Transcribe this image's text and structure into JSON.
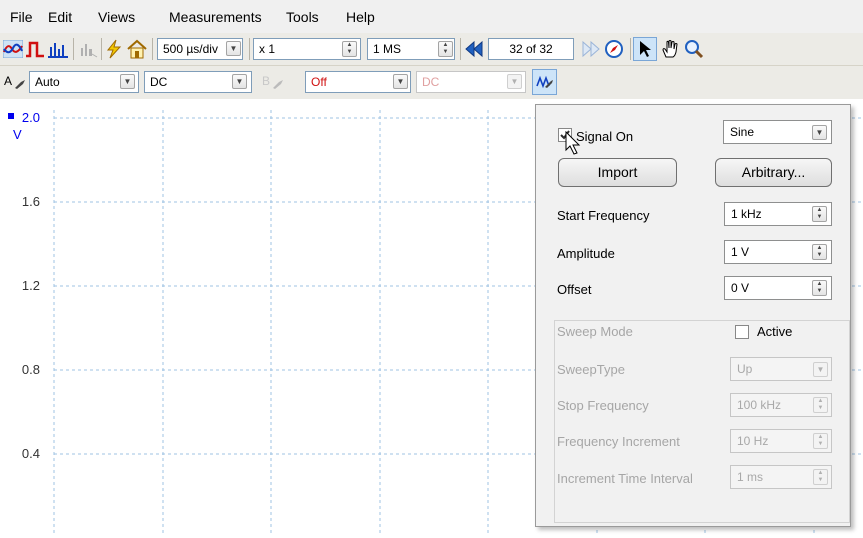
{
  "menu": {
    "file": "File",
    "edit": "Edit",
    "views": "Views",
    "measurements": "Measurements",
    "tools": "Tools",
    "help": "Help"
  },
  "toolbar": {
    "timebase": "500 µs/div",
    "zoom": "x 1",
    "samples": "1 MS",
    "buffer": "32 of 32"
  },
  "channels": {
    "a_label": "A",
    "a_range": "Auto",
    "a_coupling": "DC",
    "b_label": "B",
    "b_range": "Off",
    "b_coupling": "DC"
  },
  "chart_data": {
    "type": "line",
    "ylabel": "V",
    "yticks": [
      "2.0",
      "1.6",
      "1.2",
      "0.8",
      "0.4"
    ],
    "ylim": [
      0.0,
      2.0
    ],
    "grid": true,
    "series": []
  },
  "signal_panel": {
    "signal_on_label": "Signal On",
    "signal_on": true,
    "waveform": "Sine",
    "import_label": "Import",
    "arbitrary_label": "Arbitrary...",
    "start_frequency_label": "Start Frequency",
    "start_frequency": "1 kHz",
    "amplitude_label": "Amplitude",
    "amplitude": "1 V",
    "offset_label": "Offset",
    "offset": "0 V",
    "sweep_mode_label": "Sweep Mode",
    "active_label": "Active",
    "active": false,
    "sweep_type_label": "SweepType",
    "sweep_type": "Up",
    "stop_frequency_label": "Stop Frequency",
    "stop_frequency": "100 kHz",
    "frequency_increment_label": "Frequency Increment",
    "frequency_increment": "10 Hz",
    "increment_time_label": "Increment Time Interval",
    "increment_time": "1 ms"
  },
  "colors": {
    "grid": "#9fc3e3",
    "axis_marker": "#0000ee",
    "channel_b_red": "#d01010",
    "toolbar_bg": "#ecebe6"
  }
}
